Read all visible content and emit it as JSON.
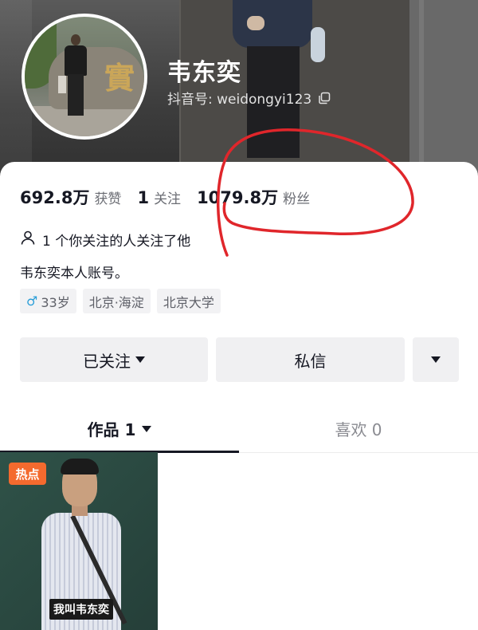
{
  "profile": {
    "name": "韦东奕",
    "douyin_id": "抖音号: weidongyi123"
  },
  "stats": {
    "likes_value": "692.8万",
    "likes_label": "获赞",
    "following_value": "1",
    "following_label": "关注",
    "followers_value": "1079.8万",
    "followers_label": "粉丝"
  },
  "mutual_text": "1 个你关注的人关注了他",
  "bio": "韦东奕本人账号。",
  "tags": {
    "age": "33岁",
    "location": "北京·海淀",
    "school": "北京大学"
  },
  "buttons": {
    "follow": "已关注",
    "message": "私信"
  },
  "tabs": {
    "works": "作品 1",
    "likes": "喜欢 0"
  },
  "video": {
    "badge": "热点",
    "caption": "我叫韦东奕"
  },
  "colors": {
    "annotation": "#e0262b",
    "hot_badge": "#f46a2e",
    "gender_icon": "#2a9ed8"
  }
}
